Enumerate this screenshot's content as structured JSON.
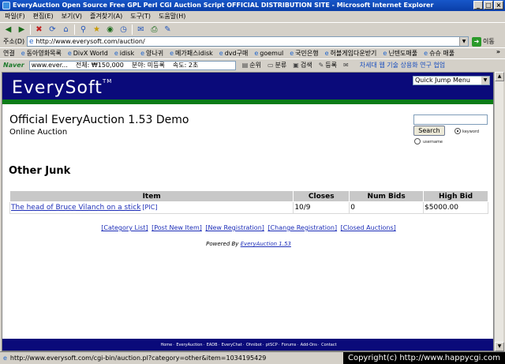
{
  "window": {
    "title": "EveryAuction Open Source Free GPL Perl CGI Auction Script OFFICIAL DISTRIBUTION SITE - Microsoft Internet Explorer",
    "minimize": "_",
    "maximize": "□",
    "close": "×"
  },
  "menu": [
    "파일(F)",
    "편집(E)",
    "보기(V)",
    "즐겨찾기(A)",
    "도구(T)",
    "도움말(H)"
  ],
  "address": {
    "label": "주소(D)",
    "url": "http://www.everysoft.com/auction/",
    "go_label": "이동"
  },
  "links": {
    "label": "연결",
    "items": [
      "동아영화목록",
      "DivX World",
      "idisk",
      "양나귀",
      "메가패스idisk",
      "dvd구매",
      "goemul",
      "국민은행",
      "허블게임다운받기",
      "닌텐도매풀",
      "슈슈 매풀"
    ],
    "more": "»"
  },
  "naver": {
    "logo": "Naver",
    "search_text": "www.ever...",
    "fields": [
      "전체: ₩150,000",
      "분야: 미등록",
      "속도: 2초"
    ],
    "buttons": [
      "순위",
      "분류",
      "검색",
      "등록"
    ],
    "promo": "차세대 웹 기술 상용화 연구 협업"
  },
  "site": {
    "logo": "EverySoft",
    "logo_tm": "TM",
    "quick_jump": "Quick Jump Menu",
    "title": "Official EveryAuction 1.53 Demo",
    "subtitle": "Online Auction",
    "search_button": "Search",
    "search_options": [
      "keyword",
      "username"
    ]
  },
  "category": {
    "title": "Other Junk"
  },
  "table": {
    "headers": [
      "Item",
      "Closes",
      "Num Bids",
      "High Bid"
    ],
    "rows": [
      {
        "item": "The head of Bruce Vilanch on a stick",
        "pic": "[PIC]",
        "closes": "10/9",
        "num_bids": "0",
        "high_bid": "$5000.00"
      }
    ]
  },
  "nav_links": [
    "[Category List]",
    "[Post New Item]",
    "[New Registration]",
    "[Change Registration]",
    "[Closed Auctions]"
  ],
  "powered": {
    "prefix": "Powered By",
    "link": "EveryAuction 1.53"
  },
  "footer_links": [
    "Home",
    "EveryAuction",
    "EADB",
    "EveryChat",
    "Ohnibot",
    "ptSCP",
    "Forums",
    "Add-Ons",
    "Contact"
  ],
  "status": {
    "url": "http://www.everysoft.com/cgi-bin/auction.pl?category=other&item=1034195429",
    "copyright": "Copyright(c) http://www.happycgi.com"
  },
  "colors": {
    "header_navy": "#0a0a7a",
    "stripe_green": "#0c7d18",
    "link_blue": "#1e2fb8"
  }
}
